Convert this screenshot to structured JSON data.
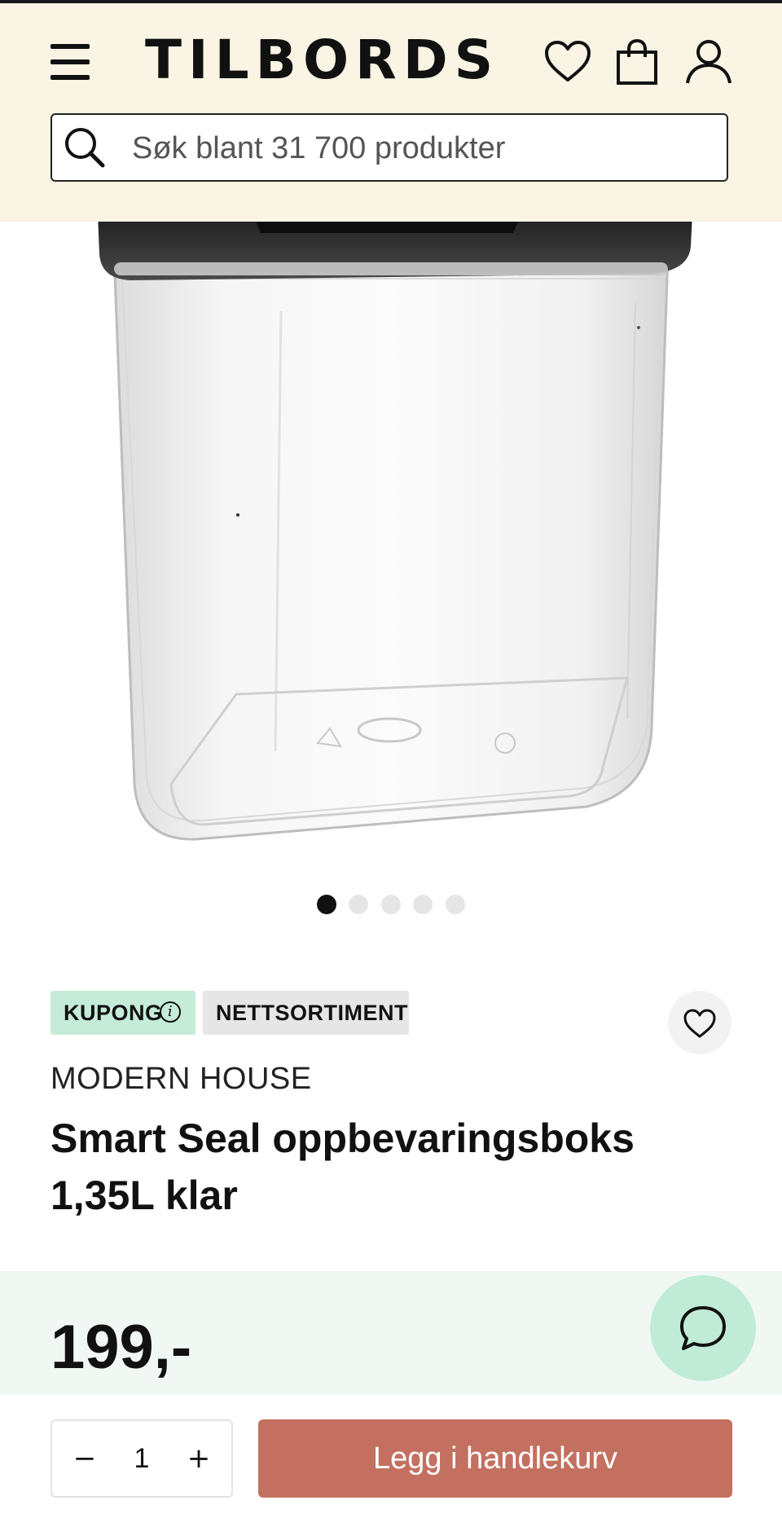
{
  "header": {
    "logo_text": "TILBORDS",
    "search": {
      "placeholder": "Søk blant 31 700 produkter"
    },
    "icons": [
      "menu-icon",
      "heart-icon",
      "shopping-bag-icon",
      "user-icon"
    ]
  },
  "gallery": {
    "image_description": "clear square storage container with black lid",
    "current_slide": 1,
    "total_slides": 5
  },
  "product": {
    "badges": {
      "coupon": "KUPONG",
      "net": "NETTSORTIMENT"
    },
    "brand": "MODERN HOUSE",
    "title_line1": "Smart Seal oppbevaringsboks",
    "title_line2": "1,35L klar",
    "price": "199,-"
  },
  "cart": {
    "quantity": "1",
    "minus_label": "−",
    "plus_label": "+",
    "add_label": "Legg i handlekurv"
  },
  "colors": {
    "header_bg": "#f9f4e3",
    "coupon_badge": "#c5ecd8",
    "net_badge": "#e6e6e6",
    "price_band": "#f1f8f4",
    "chat_button": "#c0ecd7",
    "add_button": "#c47060"
  }
}
